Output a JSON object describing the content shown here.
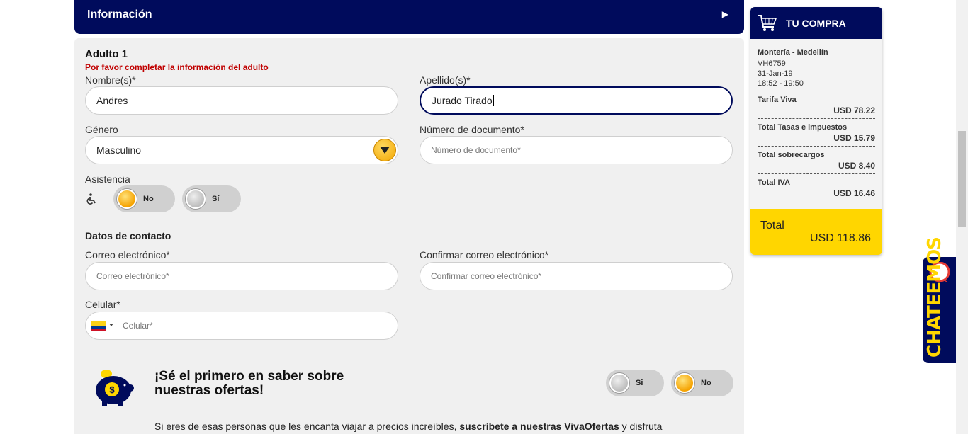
{
  "info": {
    "title": "Información",
    "arrow": "▶"
  },
  "adult": {
    "heading": "Adulto 1",
    "warning": "Por favor completar la información del adulto",
    "first_name_label": "Nombre(s)*",
    "first_name_value": "Andres",
    "last_name_label": "Apellido(s)*",
    "last_name_value": "Jurado Tirado",
    "gender_label": "Género",
    "gender_value": "Masculino",
    "doc_label": "Número de documento*",
    "doc_placeholder": "Número de documento*",
    "assist_label": "Asistencia",
    "assist_no": "No",
    "assist_yes": "Sí"
  },
  "contact": {
    "heading": "Datos de contacto",
    "email_label": "Correo electrónico*",
    "email_placeholder": "Correo electrónico*",
    "confirm_label": "Confirmar correo electrónico*",
    "confirm_placeholder": "Confirmar correo electrónico*",
    "phone_label": "Celular*",
    "phone_placeholder": "Celular*"
  },
  "promo": {
    "title_line1": "¡Sé el primero en saber sobre",
    "title_line2": "nuestras ofertas!",
    "yes": "Si",
    "no": "No",
    "text_start": "Si eres de esas personas que les encanta viajar a precios increíbles, ",
    "text_bold": "suscríbete a nuestras VivaOfertas",
    "text_end": " y disfruta"
  },
  "cart": {
    "title": "TU COMPRA",
    "route": "Montería - Medellín",
    "flight": "VH6759",
    "date": "31-Jan-19",
    "time": "18:52 - 19:50",
    "items": [
      {
        "name": "Tarifa Viva",
        "value": "USD 78.22"
      },
      {
        "name": "Total Tasas e impuestos",
        "value": "USD 15.79"
      },
      {
        "name": "Total sobrecargos",
        "value": "USD 8.40"
      },
      {
        "name": "Total IVA",
        "value": "USD 16.46"
      }
    ],
    "total_label": "Total",
    "total_value": "USD 118.86"
  },
  "chat": {
    "label": "CHATEEMOS"
  },
  "colors": {
    "navy": "#000b5c",
    "yellow": "#ffd600",
    "warning": "#c00000"
  }
}
